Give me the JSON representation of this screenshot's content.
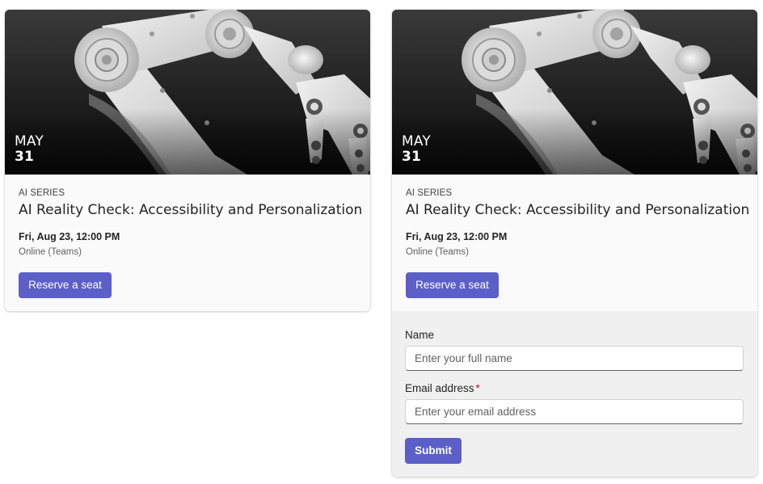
{
  "event": {
    "date_month": "MAY",
    "date_day": "31",
    "series": "AI SERIES",
    "title": "AI Reality Check: Accessibility and Personalization",
    "datetime": "Fri, Aug 23, 12:00 PM",
    "location": "Online (Teams)",
    "reserve_label": "Reserve a seat",
    "hero_image": "robotic-arm-photo"
  },
  "form": {
    "name_label": "Name",
    "name_placeholder": "Enter your full name",
    "email_label": "Email address",
    "email_required_marker": "*",
    "email_placeholder": "Enter your email address",
    "submit_label": "Submit"
  },
  "colors": {
    "accent": "#5b5fc7",
    "required": "#c50f1f",
    "card_background": "#fafafa",
    "form_background": "#f0f0f0"
  }
}
